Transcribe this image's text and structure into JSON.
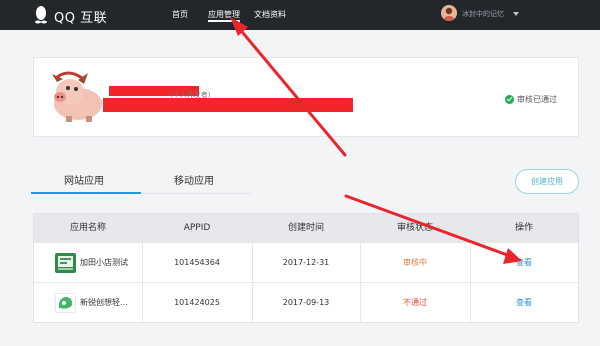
{
  "nav": {
    "brand": "QQ 互联",
    "items": [
      "首页",
      "应用管理",
      "文档资料"
    ],
    "user_name": "冰封中的记忆"
  },
  "profile": {
    "developer_type": "(个人开发者)",
    "status": "审核已通过"
  },
  "tabs": [
    "网站应用",
    "移动应用"
  ],
  "create_button": "创建应用",
  "table": {
    "headers": [
      "应用名称",
      "APPID",
      "创建时间",
      "审核状态",
      "操作"
    ],
    "rows": [
      {
        "name": "加田小店测试",
        "appid": "101454364",
        "created": "2017-12-31",
        "status": "审核中",
        "action": "查看"
      },
      {
        "name": "新锐创想轻...",
        "appid": "101424025",
        "created": "2017-09-13",
        "status": "不通过",
        "action": "查看"
      }
    ]
  },
  "colors": {
    "topbar": "#23272c",
    "accent": "#1e9ce0",
    "status_pending": "#e07b3f",
    "status_failed": "#e24a3b",
    "status_ok": "#27a95a",
    "link": "#2b8fdc",
    "annotation": "#e8262c"
  },
  "icons": [
    "qq-penguin-icon",
    "user-avatar-icon",
    "caret-down-icon",
    "check-circle-icon",
    "app-icon"
  ]
}
